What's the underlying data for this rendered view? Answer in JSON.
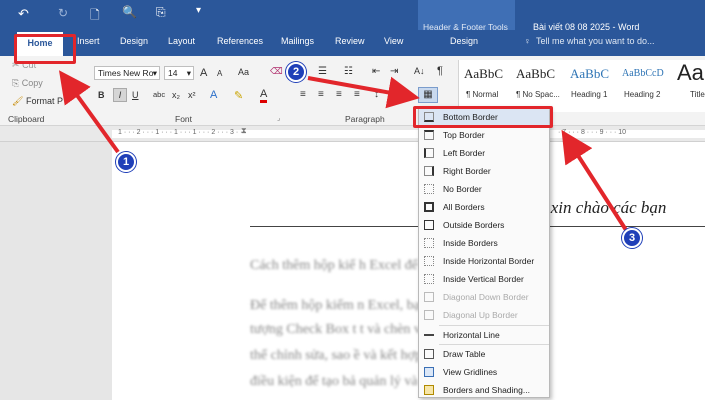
{
  "title": {
    "quick_access": [
      "↶",
      "↻",
      "🗋",
      "🔍",
      "⎘"
    ],
    "context_tab": "Header & Footer Tools",
    "doc_title": "Bài viết 08 08 2025 - Word"
  },
  "tabs": {
    "home": "Home",
    "insert": "Insert",
    "design": "Design",
    "layout": "Layout",
    "references": "References",
    "mailings": "Mailings",
    "review": "Review",
    "view": "View",
    "hf_design": "Design",
    "tell_me": "Tell me what you want to do..."
  },
  "ribbon": {
    "cut": "Cut",
    "copy": "Copy",
    "format_painter": "Format P",
    "clipboard_group": "Clipboard",
    "font_name": "Times New Ro",
    "font_size": "14",
    "font_group": "Font",
    "paragraph_group": "Paragraph",
    "bold": "B",
    "italic": "I",
    "underline": "U",
    "grow": "A",
    "shrink": "A",
    "case": "Aa",
    "sort": "A↓",
    "pilcrow": "¶",
    "styles": [
      {
        "sample": "AaBbC",
        "name": "¶ Normal"
      },
      {
        "sample": "AaBbC",
        "name": "¶ No Spac..."
      },
      {
        "sample": "AaBbC",
        "name": "Heading 1"
      },
      {
        "sample": "AaBbCcD",
        "name": "Heading 2"
      },
      {
        "sample": "Aa",
        "name": "Title"
      }
    ]
  },
  "ruler": {
    "marks": "1 · · · 2 · · · 1 · · · 1 · · · 1 · · · 2 · · · 3 · · ·",
    "marks_right": "· 7 · · · 8 · · · 9 · · · 10"
  },
  "document": {
    "header_text": "o xin chào các bạn",
    "lines": [
      "Cách thêm hộp kiể                    h Excel để tạo che",
      "Để thêm hộp kiểm                    n Excel, bạn hãy t",
      "tượng Check Box t                    t và chèn vào vị t",
      "thể chỉnh sửa, sao                    ề và kết hợp với",
      "điều kiện để tạo bả                   quản lý và chuyê"
    ]
  },
  "menu": {
    "items": [
      {
        "label": "Bottom Border",
        "icon": "bottom-border-icon",
        "enabled": true
      },
      {
        "label": "Top Border",
        "icon": "top-border-icon",
        "enabled": true
      },
      {
        "label": "Left Border",
        "icon": "left-border-icon",
        "enabled": true
      },
      {
        "label": "Right Border",
        "icon": "right-border-icon",
        "enabled": true
      },
      {
        "label": "No Border",
        "icon": "no-border-icon",
        "enabled": true
      },
      {
        "label": "All Borders",
        "icon": "all-borders-icon",
        "enabled": true
      },
      {
        "label": "Outside Borders",
        "icon": "outside-borders-icon",
        "enabled": true
      },
      {
        "label": "Inside Borders",
        "icon": "inside-borders-icon",
        "enabled": true
      },
      {
        "label": "Inside Horizontal Border",
        "icon": "inside-horizontal-border-icon",
        "enabled": true
      },
      {
        "label": "Inside Vertical Border",
        "icon": "inside-vertical-border-icon",
        "enabled": true
      },
      {
        "label": "Diagonal Down Border",
        "icon": "diagonal-down-border-icon",
        "enabled": false
      },
      {
        "label": "Diagonal Up Border",
        "icon": "diagonal-up-border-icon",
        "enabled": false
      },
      {
        "label": "Horizontal Line",
        "icon": "horizontal-line-icon",
        "enabled": true
      },
      {
        "label": "Draw Table",
        "icon": "draw-table-icon",
        "enabled": true
      },
      {
        "label": "View Gridlines",
        "icon": "view-gridlines-icon",
        "enabled": true
      },
      {
        "label": "Borders and Shading...",
        "icon": "borders-shading-icon",
        "enabled": true
      }
    ]
  },
  "annotations": {
    "step1": "1",
    "step2": "2",
    "step3": "3"
  },
  "colors": {
    "ribbon_blue": "#2b579a",
    "annotation_red": "#e2262b",
    "badge_blue": "#1f3fb8"
  }
}
